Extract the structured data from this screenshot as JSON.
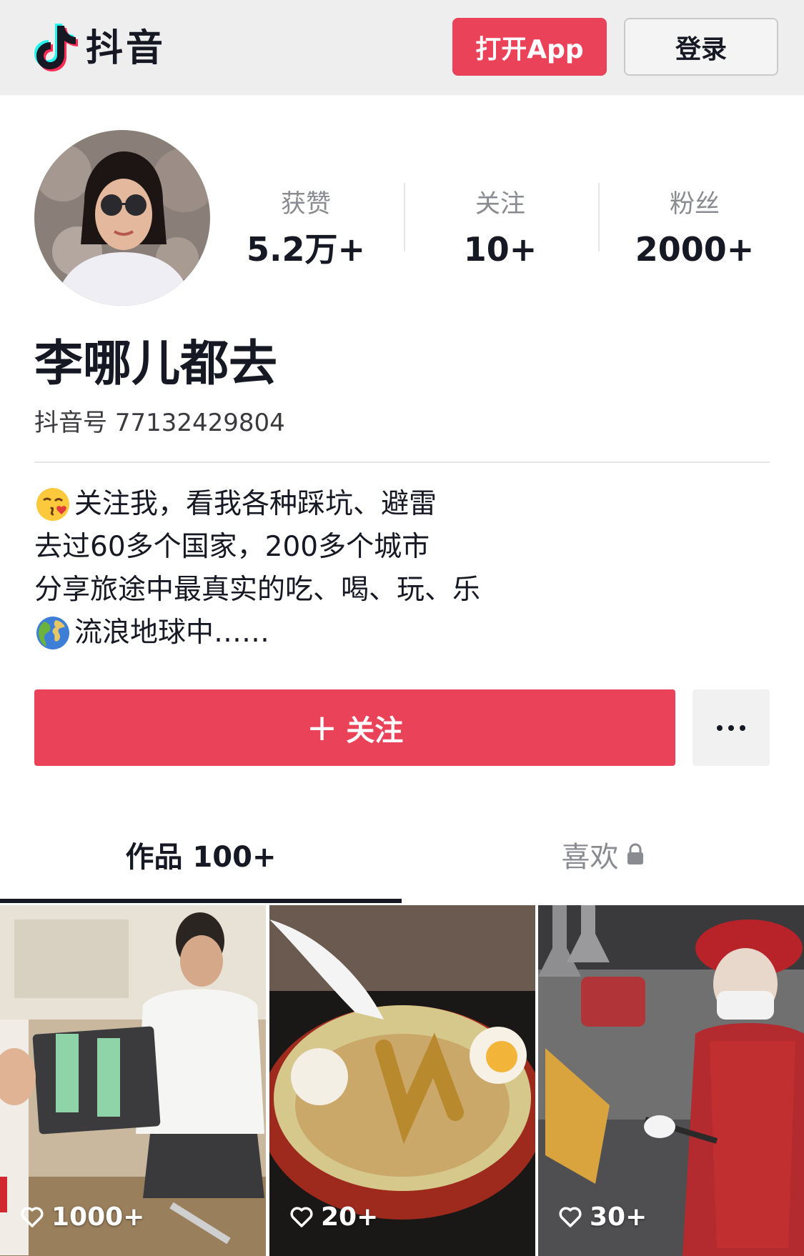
{
  "header": {
    "app_name": "抖音",
    "open_app_label": "打开App",
    "login_label": "登录"
  },
  "profile": {
    "stats": [
      {
        "label": "获赞",
        "value": "5.2万+"
      },
      {
        "label": "关注",
        "value": "10+"
      },
      {
        "label": "粉丝",
        "value": "2000+"
      }
    ],
    "nickname": "李哪儿都去",
    "douyin_id_label": "抖音号",
    "douyin_id": "77132429804",
    "bio": [
      {
        "emoji": "kiss-face",
        "text": "关注我，看我各种踩坑、避雷"
      },
      {
        "emoji": "",
        "text": "去过60多个国家，200多个城市"
      },
      {
        "emoji": "",
        "text": "分享旅途中最真实的吃、喝、玩、乐"
      },
      {
        "emoji": "globe",
        "text": "流浪地球中……"
      }
    ],
    "follow_label": "关注"
  },
  "tabs": {
    "works_label": "作品 100+",
    "likes_label": "喜欢"
  },
  "videos": [
    {
      "likes": "1000+"
    },
    {
      "likes": "20+"
    },
    {
      "likes": "30+"
    }
  ],
  "colors": {
    "accent": "#ea4259",
    "text": "#161823",
    "muted": "#8a8b91"
  }
}
